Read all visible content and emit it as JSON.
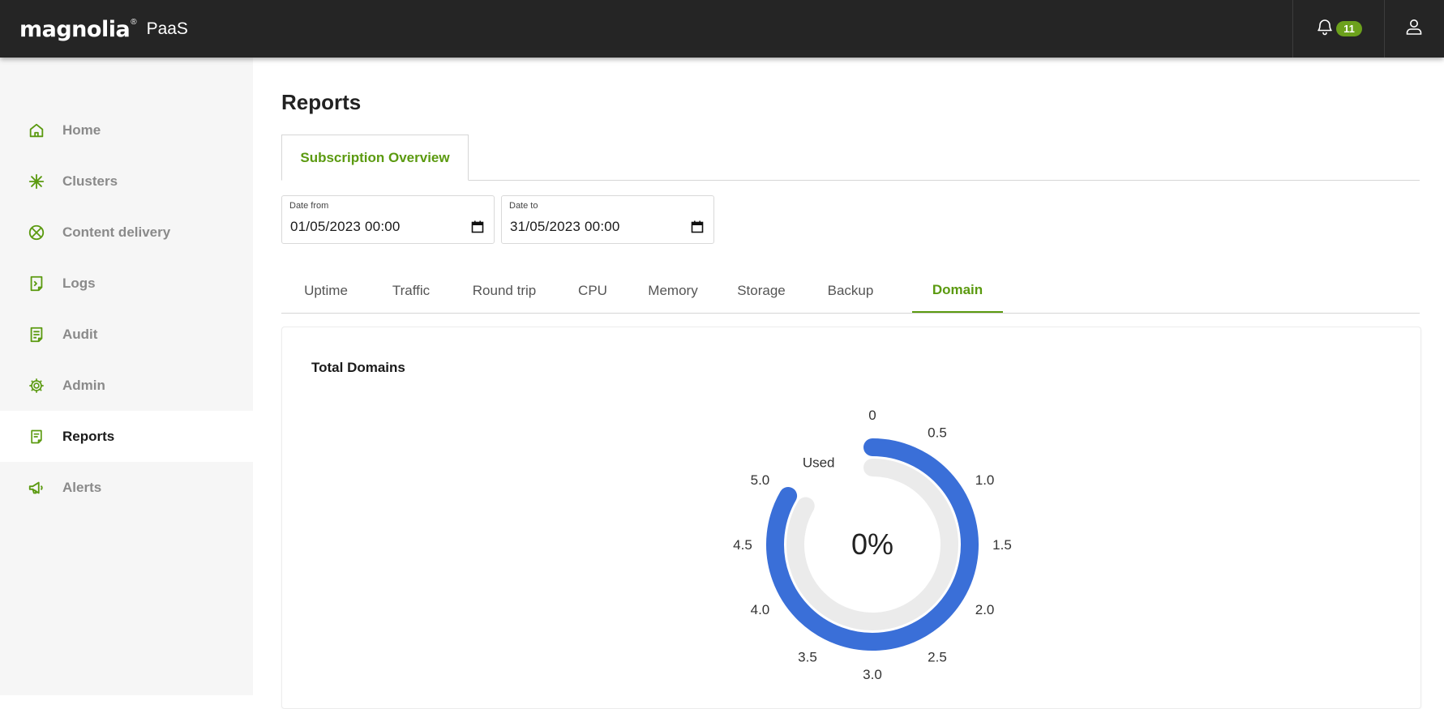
{
  "header": {
    "logo_text": "magnolia",
    "logo_reg": "®",
    "product": "PaaS",
    "notification_count": "11",
    "bell_icon": "bell-icon",
    "user_icon": "user-icon",
    "accent_color": "#6ca11c"
  },
  "sidebar": {
    "items": [
      {
        "label": "Home",
        "icon": "home-icon"
      },
      {
        "label": "Clusters",
        "icon": "clusters-icon"
      },
      {
        "label": "Content delivery",
        "icon": "content-delivery-icon"
      },
      {
        "label": "Logs",
        "icon": "logs-icon"
      },
      {
        "label": "Audit",
        "icon": "audit-icon"
      },
      {
        "label": "Admin",
        "icon": "gear-icon"
      },
      {
        "label": "Reports",
        "icon": "reports-icon",
        "active": true
      },
      {
        "label": "Alerts",
        "icon": "megaphone-icon"
      }
    ]
  },
  "main": {
    "title": "Reports",
    "subscription_tab": "Subscription Overview",
    "date_from": {
      "label": "Date from",
      "value": "01/05/2023 00:00"
    },
    "date_to": {
      "label": "Date to",
      "value": "31/05/2023 00:00"
    },
    "metric_tabs": [
      "Uptime",
      "Traffic",
      "Round trip",
      "CPU",
      "Memory",
      "Storage",
      "Backup",
      "Domain"
    ],
    "active_metric_tab": "Domain"
  },
  "chart_data": {
    "type": "gauge",
    "title": "Total Domains",
    "series_label": "Used",
    "value": 0,
    "max": 5.0,
    "center_text": "0%",
    "tick_labels": [
      "0",
      "0.5",
      "1.0",
      "1.5",
      "2.0",
      "2.5",
      "3.0",
      "3.5",
      "4.0",
      "4.5",
      "5.0"
    ],
    "arc_color": "#3a6fd8",
    "track_color": "#ebebeb"
  }
}
